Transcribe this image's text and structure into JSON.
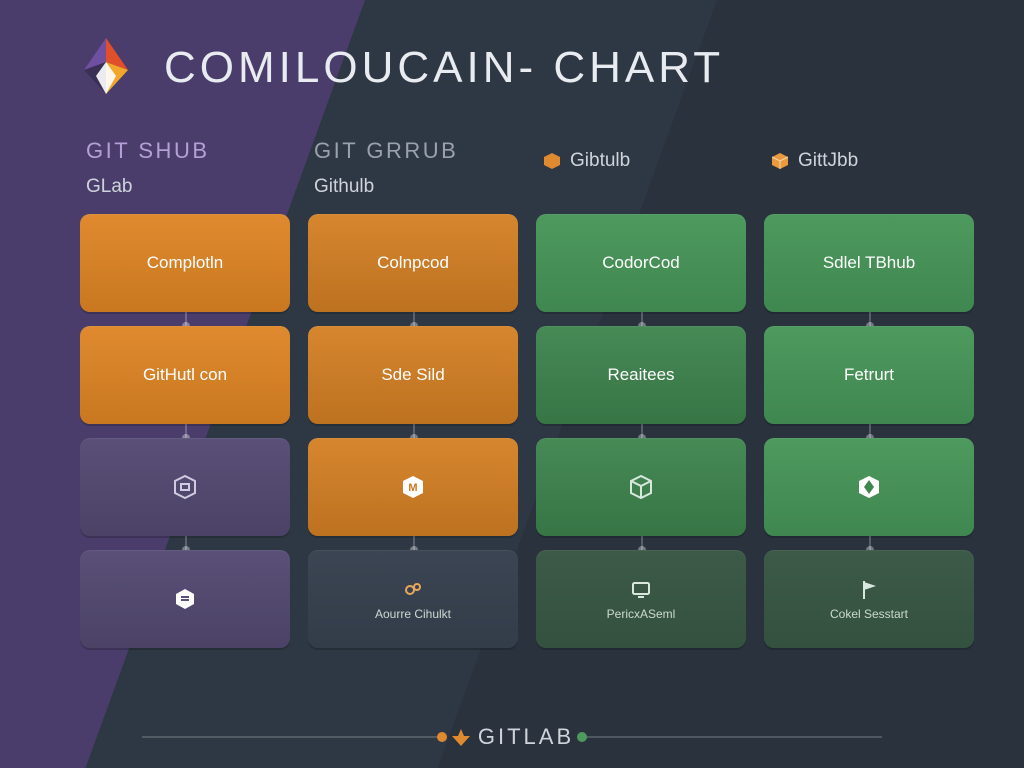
{
  "header": {
    "title": "COMILOUCAIN- CHART"
  },
  "columns": [
    {
      "top": "GIT SHUB",
      "sub": "GLab"
    },
    {
      "top": "GIT GRRUB",
      "sub": "Githulb"
    },
    {
      "top": "",
      "sub": "Gibtulb"
    },
    {
      "top": "",
      "sub": "GittJbb"
    }
  ],
  "cells": {
    "r0c0": "Complotln",
    "r0c1": "Colnpcod",
    "r0c2": "CodorCod",
    "r0c3": "Sdlel TBhub",
    "r1c0": "GitHutl con",
    "r1c1": "Sde Sild",
    "r1c2": "Reaitees",
    "r1c3": "Fetrurt",
    "r3c1": "Aourre Cihulkt",
    "r3c2": "PericxASeml",
    "r3c3": "Cokel Sesstart"
  },
  "icons": {
    "r2c0": "hex-box-icon",
    "r2c1": "hex-m-icon",
    "r2c2": "hex-cube-icon",
    "r2c3": "hex-leaf-icon",
    "r3c0": "hex-stack-icon",
    "r3c1": "gears-icon",
    "r3c2": "monitor-icon",
    "r3c3": "flag-icon",
    "sub2": "hex-orange-icon",
    "sub3": "cube-orange-icon"
  },
  "footer": {
    "label": "GITLAB"
  },
  "colors": {
    "orange": "#df8a2f",
    "green": "#4e9a5e",
    "purple": "#5a5078",
    "slate": "#3b4553"
  }
}
